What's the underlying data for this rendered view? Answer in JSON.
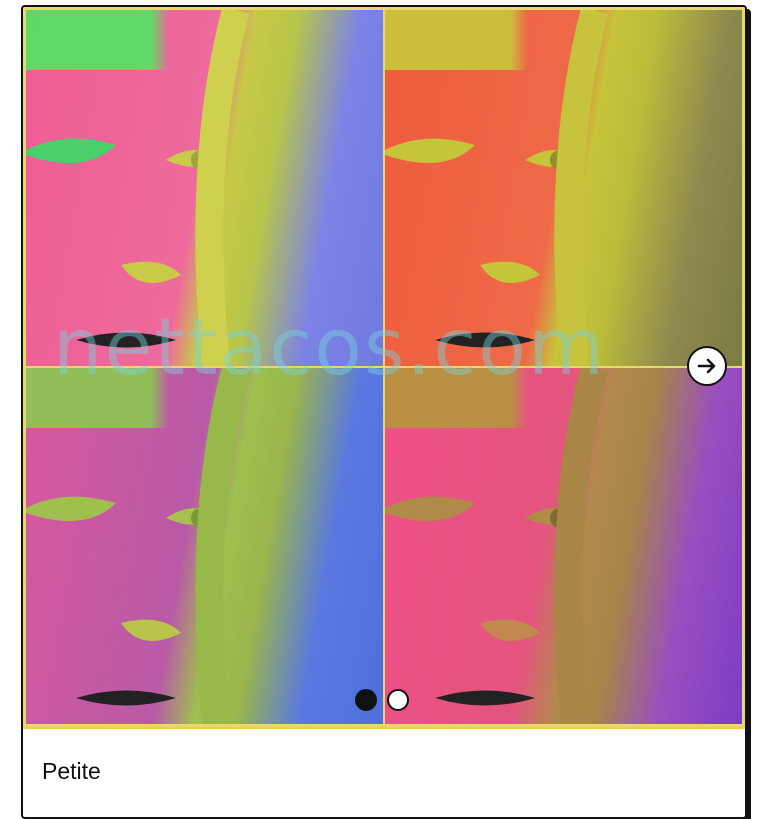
{
  "product": {
    "title": "Petite",
    "watermark": "nettacos.com"
  },
  "gallery": {
    "slide_count": 2,
    "active_slide": 1,
    "next_icon": "arrow-right-icon",
    "quadrant_tints": [
      "#ef5d95",
      "#ef5b3c",
      "#b95aa7",
      "#ef4f86"
    ]
  }
}
